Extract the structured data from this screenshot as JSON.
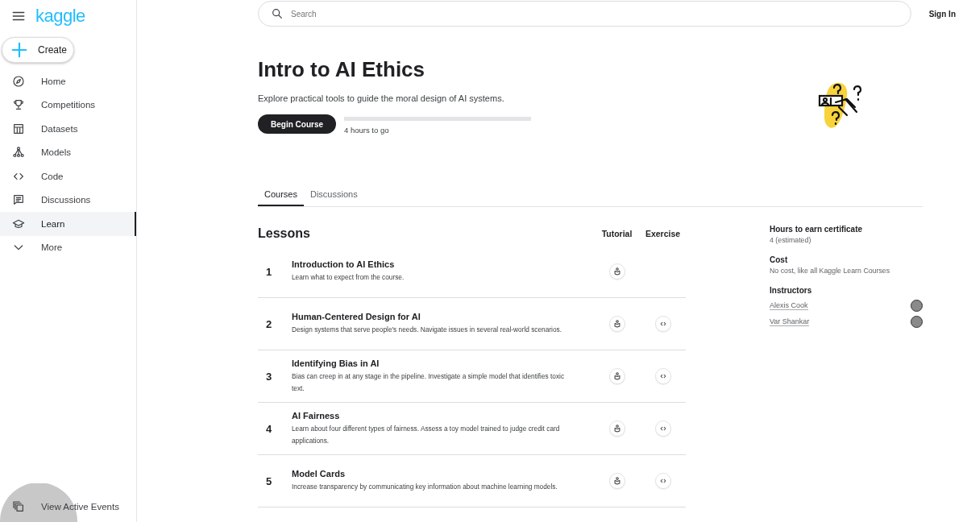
{
  "sidebar": {
    "logo": "kaggle",
    "create": "Create",
    "items": [
      {
        "label": "Home",
        "selected": false
      },
      {
        "label": "Competitions",
        "selected": false
      },
      {
        "label": "Datasets",
        "selected": false
      },
      {
        "label": "Models",
        "selected": false
      },
      {
        "label": "Code",
        "selected": false
      },
      {
        "label": "Discussions",
        "selected": false
      },
      {
        "label": "Learn",
        "selected": true
      },
      {
        "label": "More",
        "selected": false
      }
    ],
    "footer_item": "View Active Events"
  },
  "header": {
    "search": {
      "placeholder": "Search"
    },
    "sign_in": "Sign In"
  },
  "course": {
    "title": "Intro to AI Ethics",
    "subtitle": "Explore practical tools to guide the moral design of AI systems.",
    "button": "Begin Course",
    "progress": {
      "level": 0,
      "reading": "4 hours to go"
    }
  },
  "tabs": [
    {
      "label": "Courses",
      "selected": true
    },
    {
      "label": "Discussions",
      "selected": false
    }
  ],
  "lessons": {
    "title": "Lessons",
    "columns": [
      "Tutorial",
      "Exercise"
    ],
    "rows": [
      {
        "number": "1",
        "title": "Introduction to AI Ethics",
        "description": "Learn what to expect from the course.",
        "exercise": false
      },
      {
        "number": "2",
        "title": "Human-Centered Design for AI",
        "description": "Design systems that serve people's needs. Navigate issues in several real-world scenarios.",
        "exercise": true
      },
      {
        "number": "3",
        "title": "Identifying Bias in AI",
        "description": "Bias can creep in at any stage in the pipeline. Investigate a simple model that identifies toxic text.",
        "exercise": true
      },
      {
        "number": "4",
        "title": "AI Fairness",
        "description": "Learn about four different types of fairness. Assess a toy model trained to judge credit card applications.",
        "exercise": true
      },
      {
        "number": "5",
        "title": "Model Cards",
        "description": "Increase transparency by communicating key information about machine learning models.",
        "exercise": true
      }
    ]
  },
  "info": [
    {
      "label": "Hours to earn certificate",
      "value": "4 (estimated)"
    },
    {
      "label": "Cost",
      "value": "No cost, like all Kaggle Learn Courses"
    }
  ],
  "instructors": {
    "label": "Instructors",
    "people": [
      "Alexis Cook",
      "Var Shankar"
    ]
  }
}
